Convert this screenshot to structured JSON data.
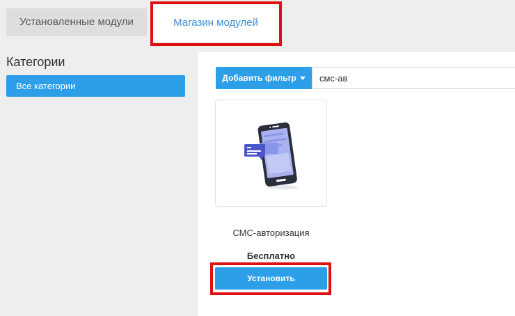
{
  "tabs": {
    "installed": "Установленные модули",
    "store": "Магазин модулей"
  },
  "sidebar": {
    "title": "Категории",
    "items": [
      {
        "label": "Все категории"
      }
    ]
  },
  "toolbar": {
    "filter_label": "Добавить фильтр",
    "search_value": "смс-ав"
  },
  "module": {
    "title": "СМС-авторизация",
    "price": "Бесплатно",
    "install_label": "Установить",
    "icon": "phone-sms-icon"
  },
  "colors": {
    "accent": "#2d9ee8",
    "highlight": "#e01010",
    "active_tab_text": "#3b8fd9"
  }
}
